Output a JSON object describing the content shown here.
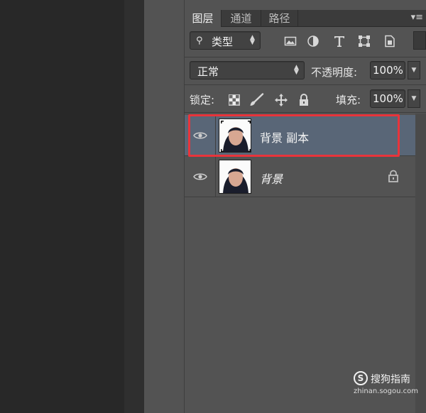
{
  "layers_panel": {
    "tabs": [
      {
        "label": "图层",
        "active": true
      },
      {
        "label": "通道",
        "active": false
      },
      {
        "label": "路径",
        "active": false
      }
    ],
    "menu_icon": "panel-menu-icon",
    "filter": {
      "search_icon": "search-icon",
      "kind_label": "类型",
      "filter_icons": [
        "image-filter-icon",
        "adjustment-filter-icon",
        "type-filter-icon",
        "shape-filter-icon",
        "smart-object-filter-icon"
      ]
    },
    "blend": {
      "mode": "正常",
      "opacity_label": "不透明度:",
      "opacity_value": "100%"
    },
    "lock": {
      "label": "锁定:",
      "icons": [
        "lock-transparent-icon",
        "lock-paint-icon",
        "lock-move-icon",
        "lock-all-icon"
      ],
      "fill_label": "填充:",
      "fill_value": "100%"
    },
    "layers": [
      {
        "name": "背景 副本",
        "visible": true,
        "selected": true,
        "locked": false
      },
      {
        "name": "背景",
        "visible": true,
        "selected": false,
        "locked": true
      }
    ],
    "colors": {
      "panel_bg": "#535353",
      "selected_layer": "#596677",
      "highlight_box": "#e8343b"
    }
  },
  "watermark": {
    "logo_letter": "S",
    "brand": "搜狗指南",
    "url": "zhinan.sogou.com"
  }
}
